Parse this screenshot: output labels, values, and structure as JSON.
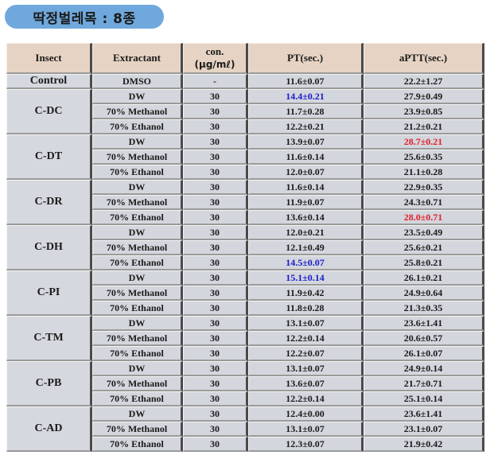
{
  "title": "딱정벌레목 : 8종",
  "table": {
    "headers": {
      "insect": "Insect",
      "extractant": "Extractant",
      "con_line1": "con.",
      "con_line2": "(μg/mℓ)",
      "pt": "PT(sec.)",
      "aptt": "aPTT(sec.)"
    },
    "control": {
      "insect": "Control",
      "extractant": "DMSO",
      "con": "-",
      "pt": "11.6±0.07",
      "aptt": "22.2±1.27"
    },
    "highlight_colors": {
      "blue": "#1a1acc",
      "red": "#e0202a"
    },
    "groups": [
      {
        "insect": "C-DC",
        "rows": [
          {
            "extractant": "DW",
            "con": "30",
            "pt": "14.4±0.21",
            "aptt": "27.9±0.49",
            "pt_hl": "blue"
          },
          {
            "extractant": "70% Methanol",
            "con": "30",
            "pt": "11.7±0.28",
            "aptt": "23.9±0.85"
          },
          {
            "extractant": "70% Ethanol",
            "con": "30",
            "pt": "12.2±0.21",
            "aptt": "21.2±0.21"
          }
        ]
      },
      {
        "insect": "C-DT",
        "rows": [
          {
            "extractant": "DW",
            "con": "30",
            "pt": "13.9±0.07",
            "aptt": "28.7±0.21",
            "aptt_hl": "red"
          },
          {
            "extractant": "70% Methanol",
            "con": "30",
            "pt": "11.6±0.14",
            "aptt": "25.6±0.35"
          },
          {
            "extractant": "70% Ethanol",
            "con": "30",
            "pt": "12.0±0.07",
            "aptt": "21.1±0.28"
          }
        ]
      },
      {
        "insect": "C-DR",
        "rows": [
          {
            "extractant": "DW",
            "con": "30",
            "pt": "11.6±0.14",
            "aptt": "22.9±0.35"
          },
          {
            "extractant": "70% Methanol",
            "con": "30",
            "pt": "11.9±0.07",
            "aptt": "24.3±0.71"
          },
          {
            "extractant": "70% Ethanol",
            "con": "30",
            "pt": "13.6±0.14",
            "aptt": "28.0±0.71",
            "aptt_hl": "red"
          }
        ]
      },
      {
        "insect": "C-DH",
        "rows": [
          {
            "extractant": "DW",
            "con": "30",
            "pt": "12.0±0.21",
            "aptt": "23.5±0.49"
          },
          {
            "extractant": "70% Methanol",
            "con": "30",
            "pt": "12.1±0.49",
            "aptt": "25.6±0.21"
          },
          {
            "extractant": "70% Ethanol",
            "con": "30",
            "pt": "14.5±0.07",
            "aptt": "25.8±0.21",
            "pt_hl": "blue"
          }
        ]
      },
      {
        "insect": "C-PI",
        "rows": [
          {
            "extractant": "DW",
            "con": "30",
            "pt": "15.1±0.14",
            "aptt": "26.1±0.21",
            "pt_hl": "blue"
          },
          {
            "extractant": "70% Methanol",
            "con": "30",
            "pt": "11.9±0.42",
            "aptt": "24.9±0.64"
          },
          {
            "extractant": "70% Ethanol",
            "con": "30",
            "pt": "11.8±0.28",
            "aptt": "21.3±0.35"
          }
        ]
      },
      {
        "insect": "C-TM",
        "rows": [
          {
            "extractant": "DW",
            "con": "30",
            "pt": "13.1±0.07",
            "aptt": "23.6±1.41"
          },
          {
            "extractant": "70% Methanol",
            "con": "30",
            "pt": "12.2±0.14",
            "aptt": "20.6±0.57"
          },
          {
            "extractant": "70% Ethanol",
            "con": "30",
            "pt": "12.2±0.07",
            "aptt": "26.1±0.07"
          }
        ]
      },
      {
        "insect": "C-PB",
        "rows": [
          {
            "extractant": "DW",
            "con": "30",
            "pt": "13.1±0.07",
            "aptt": "24.9±0.14"
          },
          {
            "extractant": "70% Methanol",
            "con": "30",
            "pt": "13.6±0.07",
            "aptt": "21.7±0.71"
          },
          {
            "extractant": "70% Ethanol",
            "con": "30",
            "pt": "12.2±0.14",
            "aptt": "25.1±0.14"
          }
        ]
      },
      {
        "insect": "C-AD",
        "rows": [
          {
            "extractant": "DW",
            "con": "30",
            "pt": "12.4±0.00",
            "aptt": "23.6±1.41"
          },
          {
            "extractant": "70% Methanol",
            "con": "30",
            "pt": "13.1±0.07",
            "aptt": "23.1±0.07"
          },
          {
            "extractant": "70% Ethanol",
            "con": "30",
            "pt": "12.3±0.07",
            "aptt": "21.9±0.42"
          }
        ]
      }
    ]
  }
}
